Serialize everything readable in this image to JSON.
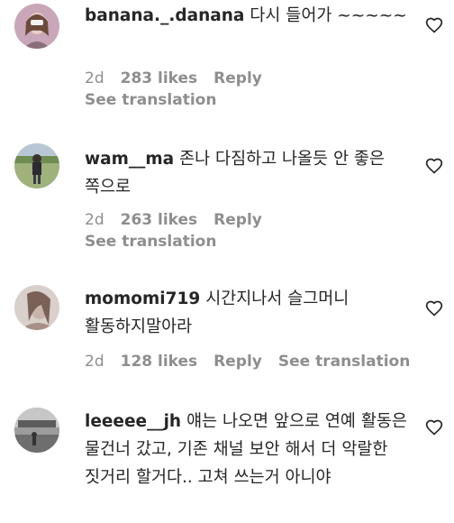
{
  "comments": [
    {
      "username": "banana._.danana",
      "text": "다시 들어가 ~~~~~",
      "time": "2d",
      "likes": "283 likes",
      "reply": "Reply",
      "translation": "See translation"
    },
    {
      "username": "wam__ma",
      "text": "존나 다짐하고 나올듯 안 좋은 쪽으로",
      "time": "2d",
      "likes": "263 likes",
      "reply": "Reply",
      "translation": "See translation"
    },
    {
      "username": "momomi719",
      "text": "시간지나서 슬그머니 활동하지말아라",
      "time": "2d",
      "likes": "128 likes",
      "reply": "Reply",
      "translation": "See translation"
    },
    {
      "username": "leeeee__jh",
      "text": "얘는 나오면 앞으로 연예 활동은 물건너 갔고, 기존 채널 보안 해서 더 악랄한 짓거리 할거다.. 고쳐 쓰는거 아니야"
    }
  ],
  "icons": {
    "like": "heart-outline-icon"
  },
  "colors": {
    "text": "#262626",
    "secondary": "#8e8e8e"
  }
}
